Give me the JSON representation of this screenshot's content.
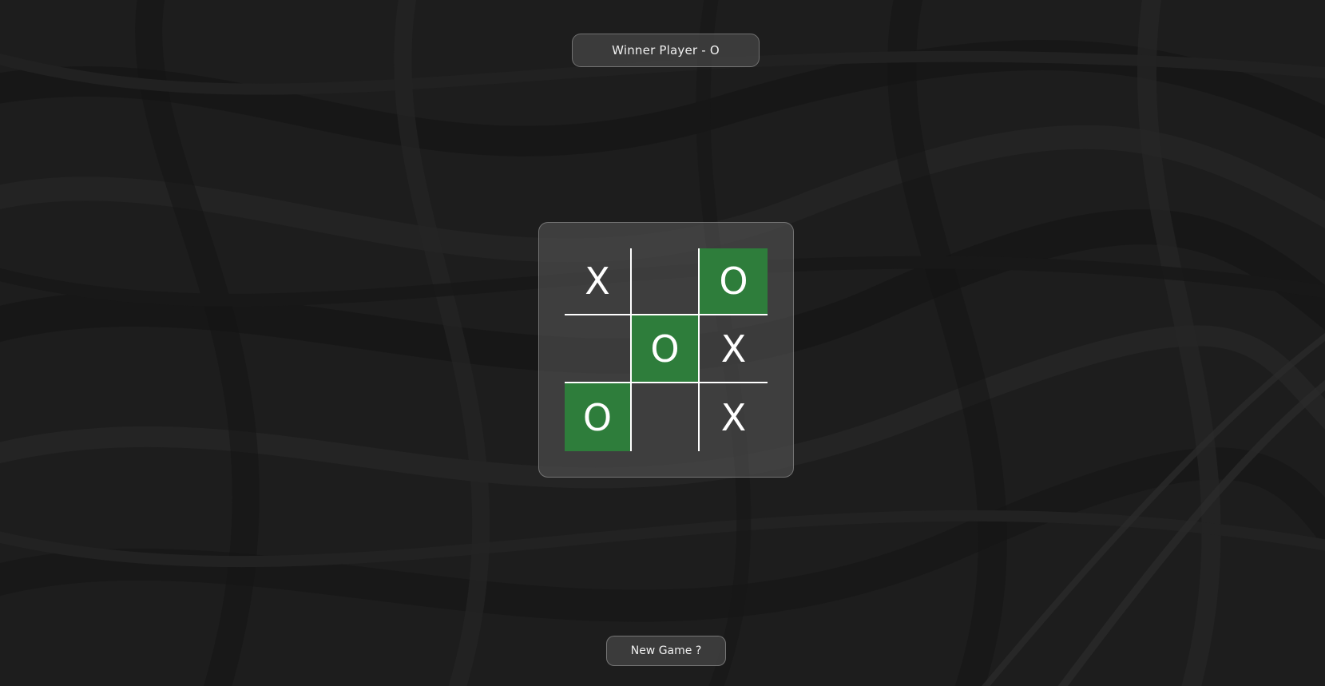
{
  "status": {
    "text": "Winner Player - O"
  },
  "board": {
    "cells": [
      {
        "mark": "X",
        "win": false
      },
      {
        "mark": "",
        "win": false
      },
      {
        "mark": "O",
        "win": true
      },
      {
        "mark": "",
        "win": false
      },
      {
        "mark": "O",
        "win": true
      },
      {
        "mark": "X",
        "win": false
      },
      {
        "mark": "O",
        "win": true
      },
      {
        "mark": "",
        "win": false
      },
      {
        "mark": "X",
        "win": false
      }
    ],
    "winner": "O"
  },
  "actions": {
    "new_game_label": "New Game ?"
  },
  "colors": {
    "background": "#1c1c1c",
    "win_cell": "#2e7d3b",
    "grid_line": "#ffffff",
    "mark": "#ffffff"
  }
}
